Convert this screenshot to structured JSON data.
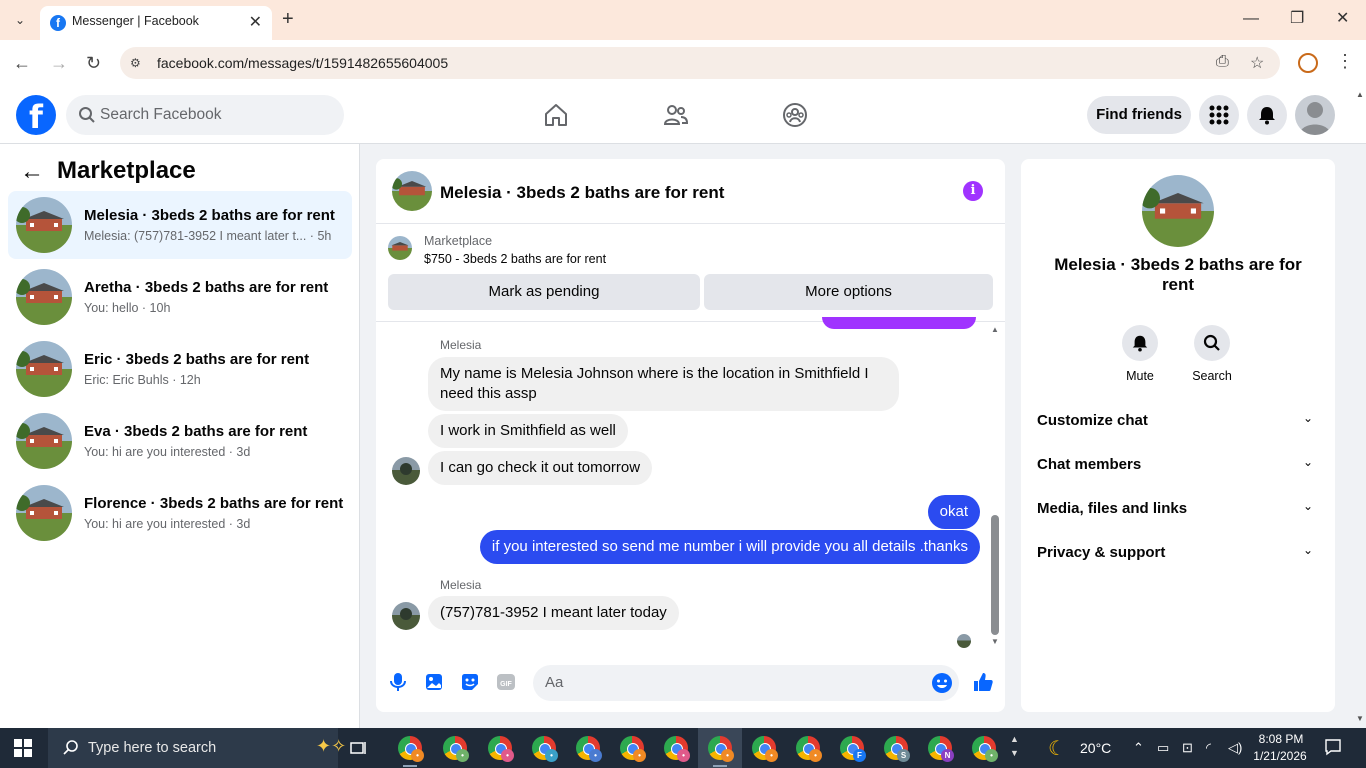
{
  "browser": {
    "tab_title": "Messenger | Facebook",
    "url": "facebook.com/messages/t/1591482655604005"
  },
  "fb": {
    "search_placeholder": "Search Facebook",
    "find_friends": "Find friends"
  },
  "sidebar": {
    "title": "Marketplace",
    "conversations": [
      {
        "title": "Melesia · 3beds 2 baths are for rent",
        "subtitle": "Melesia: (757)781-3952 I meant later t... · 5h",
        "active": true
      },
      {
        "title": "Aretha · 3beds 2 baths are for rent",
        "subtitle": "You: hello · 10h",
        "active": false
      },
      {
        "title": "Eric · 3beds 2 baths are for rent",
        "subtitle": "Eric: Eric Buhls · 12h",
        "active": false
      },
      {
        "title": "Eva · 3beds 2 baths are for rent",
        "subtitle": "You: hi are you interested · 3d",
        "active": false
      },
      {
        "title": "Florence · 3beds 2 baths are for rent",
        "subtitle": "You: hi are you interested · 3d",
        "active": false
      }
    ]
  },
  "chat": {
    "title": "Melesia · 3beds 2 baths are for rent",
    "marketplace_label": "Marketplace",
    "listing": "$750 - 3beds 2 baths are for rent",
    "mark_pending": "Mark as pending",
    "more_options": "More options",
    "messages": {
      "sender1": "Melesia",
      "in1": "My name is Melesia Johnson where is the location in Smithfield I need this assp",
      "in2": "I work in Smithfield as well",
      "in3": "I can go check it out tomorrow",
      "out1": "okat",
      "out2": "if you interested so send me number i will provide you all details .thanks",
      "sender2": "Melesia",
      "in4": "(757)781-3952 I meant later today"
    },
    "composer_placeholder": "Aa"
  },
  "details": {
    "name": "Melesia · 3beds 2 baths are for rent",
    "mute": "Mute",
    "search": "Search",
    "sections": [
      "Customize chat",
      "Chat members",
      "Media, files and links",
      "Privacy & support"
    ]
  },
  "taskbar": {
    "search_placeholder": "Type here to search",
    "temperature": "20°C",
    "time": "8:08 PM",
    "date": "1/21/2026"
  },
  "colors": {
    "fb_blue": "#0866ff",
    "outgoing_bubble": "#2b4bf0",
    "accent_purple": "#a033ff"
  }
}
